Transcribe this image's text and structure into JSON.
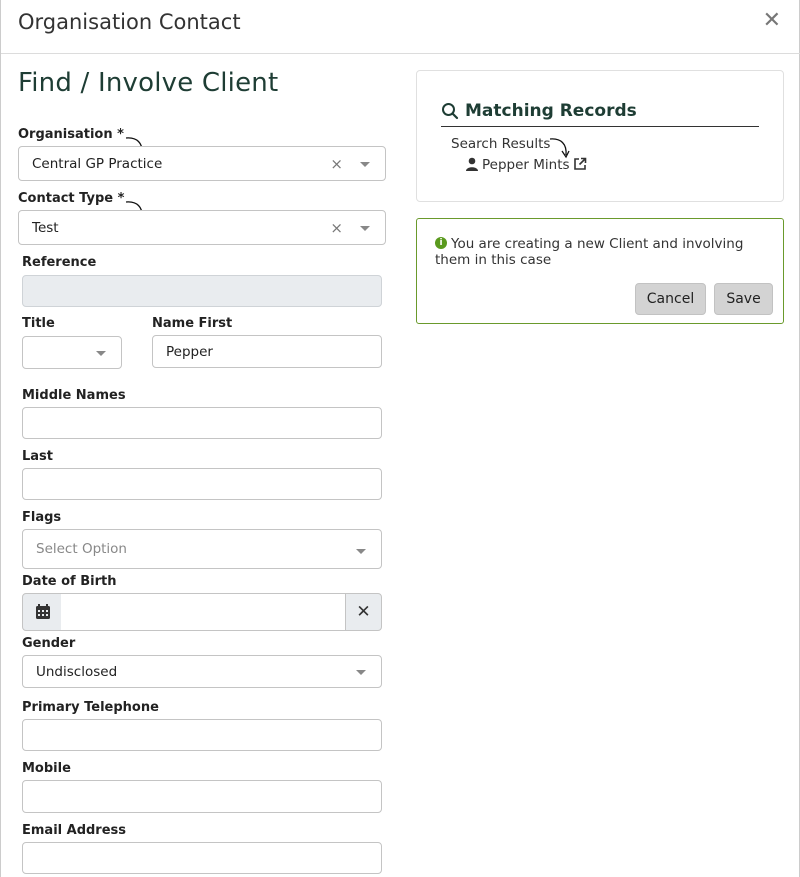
{
  "modal": {
    "title": "Organisation Contact",
    "close_icon": "close-icon"
  },
  "form": {
    "title": "Find / Involve Client",
    "organisation": {
      "label": "Organisation *",
      "value": "Central GP Practice",
      "clear": "×"
    },
    "contact_type": {
      "label": "Contact Type *",
      "value": "Test",
      "clear": "×"
    },
    "reference": {
      "label": "Reference",
      "value": ""
    },
    "title_field": {
      "label": "Title",
      "value": ""
    },
    "name_first": {
      "label": "Name First",
      "value": "Pepper"
    },
    "middle_names": {
      "label": "Middle Names",
      "value": ""
    },
    "last": {
      "label": "Last",
      "value": ""
    },
    "flags": {
      "label": "Flags",
      "placeholder": "Select Option"
    },
    "date_of_birth": {
      "label": "Date of Birth",
      "value": "",
      "clear": "✕"
    },
    "gender": {
      "label": "Gender",
      "value": "Undisclosed"
    },
    "primary_telephone": {
      "label": "Primary Telephone",
      "value": ""
    },
    "mobile": {
      "label": "Mobile",
      "value": ""
    },
    "email_address": {
      "label": "Email Address",
      "value": ""
    }
  },
  "matching": {
    "title": "Matching Records",
    "search_results_label": "Search Results",
    "results": [
      {
        "name": "Pepper Mints"
      }
    ]
  },
  "notice": {
    "text": "You are creating a new Client and involving them in this case",
    "cancel_label": "Cancel",
    "save_label": "Save"
  },
  "colors": {
    "heading": "#1e3d34",
    "notice_border": "#6a9a2c",
    "info_icon": "#5a9a1e",
    "button_bg": "#d3d3d3"
  }
}
